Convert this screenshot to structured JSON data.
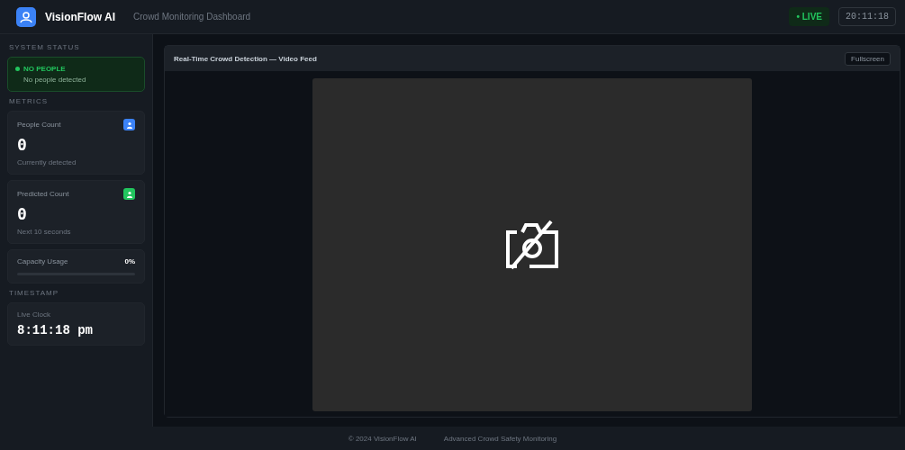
{
  "header": {
    "brand": "VisionFlow AI",
    "subtitle": "Crowd Monitoring Dashboard",
    "live": "• LIVE",
    "clock": "20:11:18"
  },
  "sidebar": {
    "status_heading": "SYSTEM STATUS",
    "status": {
      "label": "NO PEOPLE",
      "detail": "No people detected",
      "color": "#22c55e"
    },
    "metrics_heading": "METRICS",
    "metrics": [
      {
        "kind": "count",
        "label": "People Count",
        "value": "0",
        "note": "Currently detected",
        "color": "#3b82f6"
      },
      {
        "kind": "count",
        "label": "Predicted Count",
        "value": "0",
        "note": "Next 10 seconds",
        "color": "#22c55e"
      },
      {
        "kind": "gauge",
        "label": "Capacity Usage",
        "value": "0%",
        "level": 0
      }
    ],
    "time_heading": "TIMESTAMP",
    "time": {
      "label": "Live Clock",
      "value": "8:11:18 pm"
    }
  },
  "feed": {
    "title": "Real-Time Crowd Detection — Video Feed",
    "button": "Fullscreen"
  },
  "footer": {
    "left": "© 2024 VisionFlow AI",
    "right": "Advanced Crowd Safety Monitoring"
  }
}
